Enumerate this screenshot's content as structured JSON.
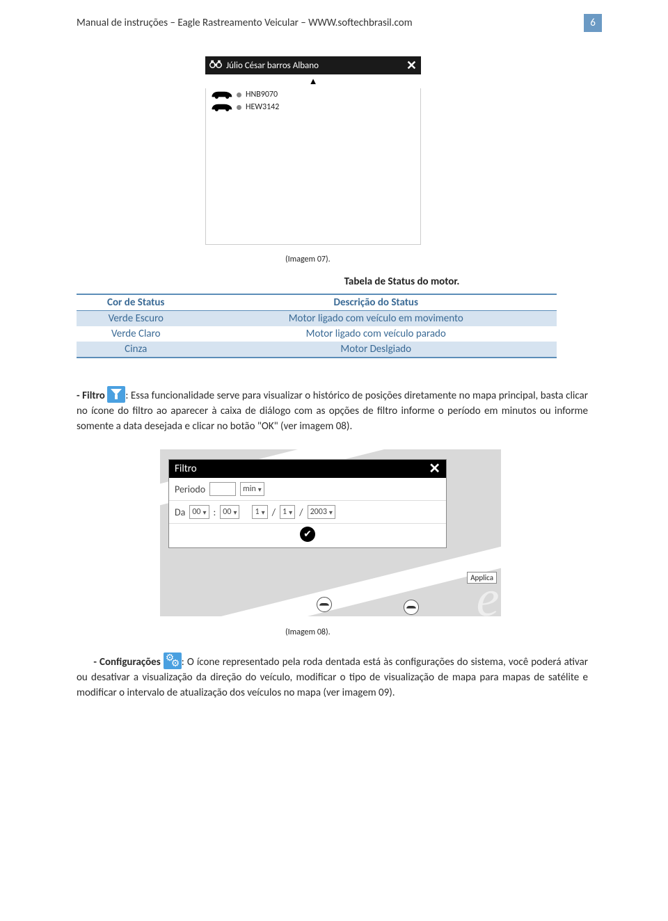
{
  "header": {
    "text": "Manual de instruções – Eagle Rastreamento Veicular – WWW.softechbrasil.com",
    "page": "6"
  },
  "img07": {
    "user": "Júlio César barros Albano",
    "items": [
      {
        "plate": "HNB9070"
      },
      {
        "plate": "HEW3142"
      }
    ],
    "caption": "(Imagem 07)."
  },
  "table": {
    "title": "Tabela de Status do motor.",
    "h1": "Cor de Status",
    "h2": "Descrição do Status",
    "rows": [
      {
        "c": "Verde Escuro",
        "d": "Motor ligado com veículo em movimento"
      },
      {
        "c": "Verde Claro",
        "d": "Motor ligado com veículo parado"
      },
      {
        "c": "Cinza",
        "d": "Motor Deslgiado"
      }
    ]
  },
  "filtroPara": {
    "lead": "- Filtro",
    "rest": ": Essa funcionalidade serve para visualizar o histórico de posições diretamente no mapa principal, basta clicar no ícone do filtro ao aparecer à caixa de diálogo com as opções de filtro informe o período em minutos ou informe somente a data desejada e clicar no botão \"OK\" (ver imagem 08)."
  },
  "img08": {
    "title": "Filtro",
    "periodoLabel": "Periodo",
    "minLabel": "min",
    "daLabel": "Da",
    "hh": "00",
    "mm": "00",
    "d": "1",
    "m": "1",
    "y": "2003",
    "tooltip": "Applica",
    "caption": "(Imagem 08)."
  },
  "configPara": {
    "lead": "- Configurações",
    "rest": ": O ícone representado pela roda dentada está às configurações do sistema, você poderá ativar ou desativar a visualização da direção do veículo, modificar o tipo de visualização de mapa para mapas de satélite e modificar o intervalo de atualização dos veículos no mapa (ver imagem 09)."
  }
}
